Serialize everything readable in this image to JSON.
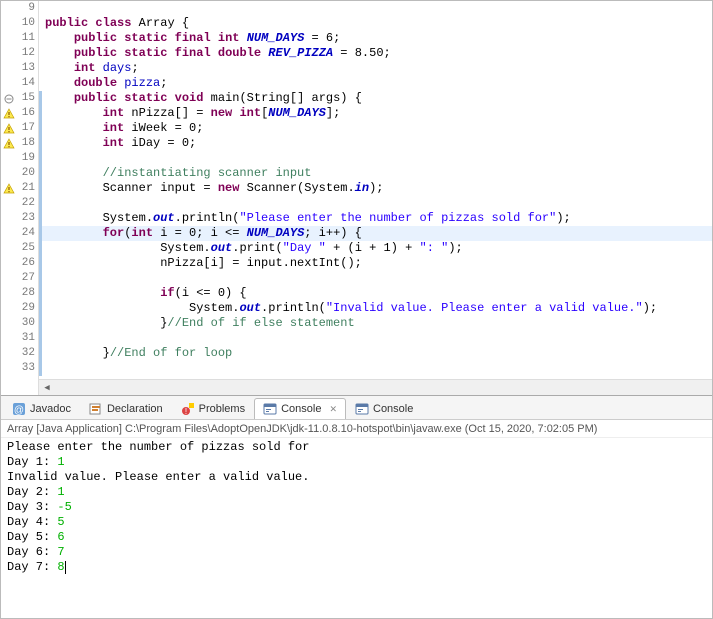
{
  "code": {
    "lines": [
      {
        "n": 9,
        "marker": "",
        "blue": false,
        "hl": false,
        "html": ""
      },
      {
        "n": 10,
        "marker": "",
        "blue": false,
        "hl": false,
        "html": "<span class='kw'>public</span> <span class='kw'>class</span> Array {"
      },
      {
        "n": 11,
        "marker": "",
        "blue": false,
        "hl": false,
        "html": "    <span class='kw'>public</span> <span class='kw'>static</span> <span class='kw'>final</span> <span class='kw'>int</span> <span class='sta'>NUM_DAYS</span> = 6;"
      },
      {
        "n": 12,
        "marker": "",
        "blue": false,
        "hl": false,
        "html": "    <span class='kw'>public</span> <span class='kw'>static</span> <span class='kw'>final</span> <span class='kw'>double</span> <span class='sta'>REV_PIZZA</span> = 8.50;"
      },
      {
        "n": 13,
        "marker": "",
        "blue": false,
        "hl": false,
        "html": "    <span class='kw'>int</span> <span class='fld'>days</span>;"
      },
      {
        "n": 14,
        "marker": "",
        "blue": false,
        "hl": false,
        "html": "    <span class='kw'>double</span> <span class='fld'>pizza</span>;"
      },
      {
        "n": 15,
        "marker": "collapse",
        "blue": true,
        "hl": false,
        "html": "    <span class='kw'>public</span> <span class='kw'>static</span> <span class='kw'>void</span> main(String[] args) {"
      },
      {
        "n": 16,
        "marker": "warn",
        "blue": true,
        "hl": false,
        "html": "        <span class='kw'>int</span> nPizza[] = <span class='kw'>new</span> <span class='kw'>int</span>[<span class='sta'>NUM_DAYS</span>];"
      },
      {
        "n": 17,
        "marker": "warn",
        "blue": true,
        "hl": false,
        "html": "        <span class='kw'>int</span> iWeek = 0;"
      },
      {
        "n": 18,
        "marker": "warn",
        "blue": true,
        "hl": false,
        "html": "        <span class='kw'>int</span> iDay = 0;"
      },
      {
        "n": 19,
        "marker": "",
        "blue": true,
        "hl": false,
        "html": ""
      },
      {
        "n": 20,
        "marker": "",
        "blue": true,
        "hl": false,
        "html": "        <span class='com'>//instantiating scanner input</span>"
      },
      {
        "n": 21,
        "marker": "warn",
        "blue": true,
        "hl": false,
        "html": "        Scanner input = <span class='kw'>new</span> Scanner(System.<span class='sta'>in</span>);"
      },
      {
        "n": 22,
        "marker": "",
        "blue": true,
        "hl": false,
        "html": ""
      },
      {
        "n": 23,
        "marker": "",
        "blue": true,
        "hl": false,
        "html": "        System.<span class='sta'>out</span>.println(<span class='str'>\"Please enter the number of pizzas sold for\"</span>);"
      },
      {
        "n": 24,
        "marker": "",
        "blue": true,
        "hl": true,
        "html": "        <span class='kw'>for</span>(<span class='kw'>int</span> i = 0; i &lt;= <span class='sta'>NUM_DAYS</span>; i++) {"
      },
      {
        "n": 25,
        "marker": "",
        "blue": true,
        "hl": false,
        "html": "                System.<span class='sta'>out</span>.print(<span class='str'>\"Day \"</span> + (i + 1) + <span class='str'>\": \"</span>);"
      },
      {
        "n": 26,
        "marker": "",
        "blue": true,
        "hl": false,
        "html": "                nPizza[i] = input.nextInt();"
      },
      {
        "n": 27,
        "marker": "",
        "blue": true,
        "hl": false,
        "html": ""
      },
      {
        "n": 28,
        "marker": "",
        "blue": true,
        "hl": false,
        "html": "                <span class='kw'>if</span>(i &lt;= 0) {"
      },
      {
        "n": 29,
        "marker": "",
        "blue": true,
        "hl": false,
        "html": "                    System.<span class='sta'>out</span>.println(<span class='str'>\"Invalid value. Please enter a valid value.\"</span>);"
      },
      {
        "n": 30,
        "marker": "",
        "blue": true,
        "hl": false,
        "html": "                }<span class='com'>//End of if else statement</span>"
      },
      {
        "n": 31,
        "marker": "",
        "blue": true,
        "hl": false,
        "html": ""
      },
      {
        "n": 32,
        "marker": "",
        "blue": true,
        "hl": false,
        "html": "        }<span class='com'>//End of for loop</span>"
      },
      {
        "n": 33,
        "marker": "",
        "blue": true,
        "hl": false,
        "html": ""
      }
    ]
  },
  "tabs": [
    {
      "id": "javadoc",
      "label": "Javadoc",
      "icon": "javadoc-icon",
      "active": false
    },
    {
      "id": "declaration",
      "label": "Declaration",
      "icon": "declaration-icon",
      "active": false
    },
    {
      "id": "problems",
      "label": "Problems",
      "icon": "problems-icon",
      "active": false
    },
    {
      "id": "console1",
      "label": "Console",
      "icon": "console-icon",
      "active": true
    },
    {
      "id": "console2",
      "label": "Console",
      "icon": "console-icon",
      "active": false
    }
  ],
  "console": {
    "header": "Array [Java Application] C:\\Program Files\\AdoptOpenJDK\\jdk-11.0.8.10-hotspot\\bin\\javaw.exe  (Oct 15, 2020, 7:02:05 PM)",
    "lines": [
      {
        "out": "Please enter the number of pizzas sold for",
        "in": ""
      },
      {
        "out": "Day 1: ",
        "in": "1"
      },
      {
        "out": "Invalid value. Please enter a valid value.",
        "in": ""
      },
      {
        "out": "Day 2: ",
        "in": "1"
      },
      {
        "out": "Day 3: ",
        "in": "-5"
      },
      {
        "out": "Day 4: ",
        "in": "5"
      },
      {
        "out": "Day 5: ",
        "in": "6"
      },
      {
        "out": "Day 6: ",
        "in": "7"
      },
      {
        "out": "Day 7: ",
        "in": "8",
        "cursor": true
      }
    ]
  },
  "icons": {
    "javadoc": "<svg width='14' height='14'><rect x='1' y='1' width='12' height='12' rx='2' fill='#6aa0d8'/><text x='7' y='11' font-size='10' text-anchor='middle' fill='#fff' font-family='sans-serif'>@</text></svg>",
    "declaration": "<svg width='14' height='14'><rect x='1' y='2' width='10' height='10' fill='#fff' stroke='#888'/><rect x='3' y='4' width='8' height='2' fill='#d08030'/><rect x='3' y='7' width='6' height='2' fill='#d08030'/></svg>",
    "problems": "<svg width='14' height='14'><circle cx='5' cy='9' r='4' fill='#d44'/><text x='5' y='12' font-size='8' text-anchor='middle' fill='#fff'>!</text><rect x='8' y='1' width='5' height='5' fill='#fc0'/></svg>",
    "console": "<svg width='14' height='14'><rect x='1' y='2' width='12' height='10' rx='1' fill='#fff' stroke='#5a7aa8'/><rect x='1' y='2' width='12' height='3' fill='#5a7aa8'/><rect x='3' y='7' width='5' height='1' fill='#5a7aa8'/><rect x='3' y='9' width='3' height='1' fill='#5a7aa8'/></svg>",
    "warn": "<svg width='12' height='12'><path d='M6 1 L11 10 L1 10 Z' fill='#fce94f' stroke='#c4a000' stroke-width='0.7'/><rect x='5.4' y='4' width='1.2' height='3' fill='#8f5902'/><rect x='5.4' y='8' width='1.2' height='1.2' fill='#8f5902'/></svg>",
    "collapse": "<svg width='10' height='10'><circle cx='5' cy='5' r='4' fill='#fff' stroke='#888'/><rect x='2.5' y='4.5' width='5' height='1' fill='#888'/></svg>"
  }
}
